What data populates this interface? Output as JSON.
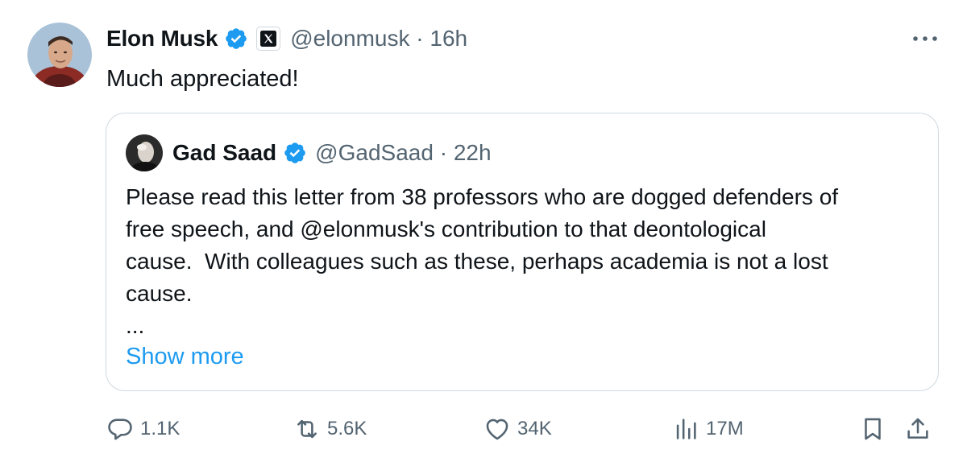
{
  "tweet": {
    "author_name": "Elon Musk",
    "handle": "@elonmusk",
    "time": "16h",
    "text": "Much appreciated!"
  },
  "quote": {
    "author_name": "Gad Saad",
    "handle": "@GadSaad",
    "time": "22h",
    "text": "Please read this letter from 38 professors who are dogged defenders of\nfree speech, and @elonmusk's contribution to that deontological\ncause.  With colleagues such as these, perhaps academia is not a lost\ncause.",
    "ellipsis": "...",
    "show_more": "Show more"
  },
  "actions": {
    "replies": "1.1K",
    "reposts": "5.6K",
    "likes": "34K",
    "views": "17M"
  },
  "icons": {
    "verified": "verified-badge-icon",
    "affiliate": "x-logo-icon",
    "more": "more-icon",
    "reply": "reply-icon",
    "repost": "repost-icon",
    "like": "heart-icon",
    "views": "views-icon",
    "bookmark": "bookmark-icon",
    "share": "share-icon"
  },
  "colors": {
    "text": "#0f1419",
    "secondary": "#536471",
    "accent": "#1d9bf0",
    "border": "#cfd9de"
  }
}
